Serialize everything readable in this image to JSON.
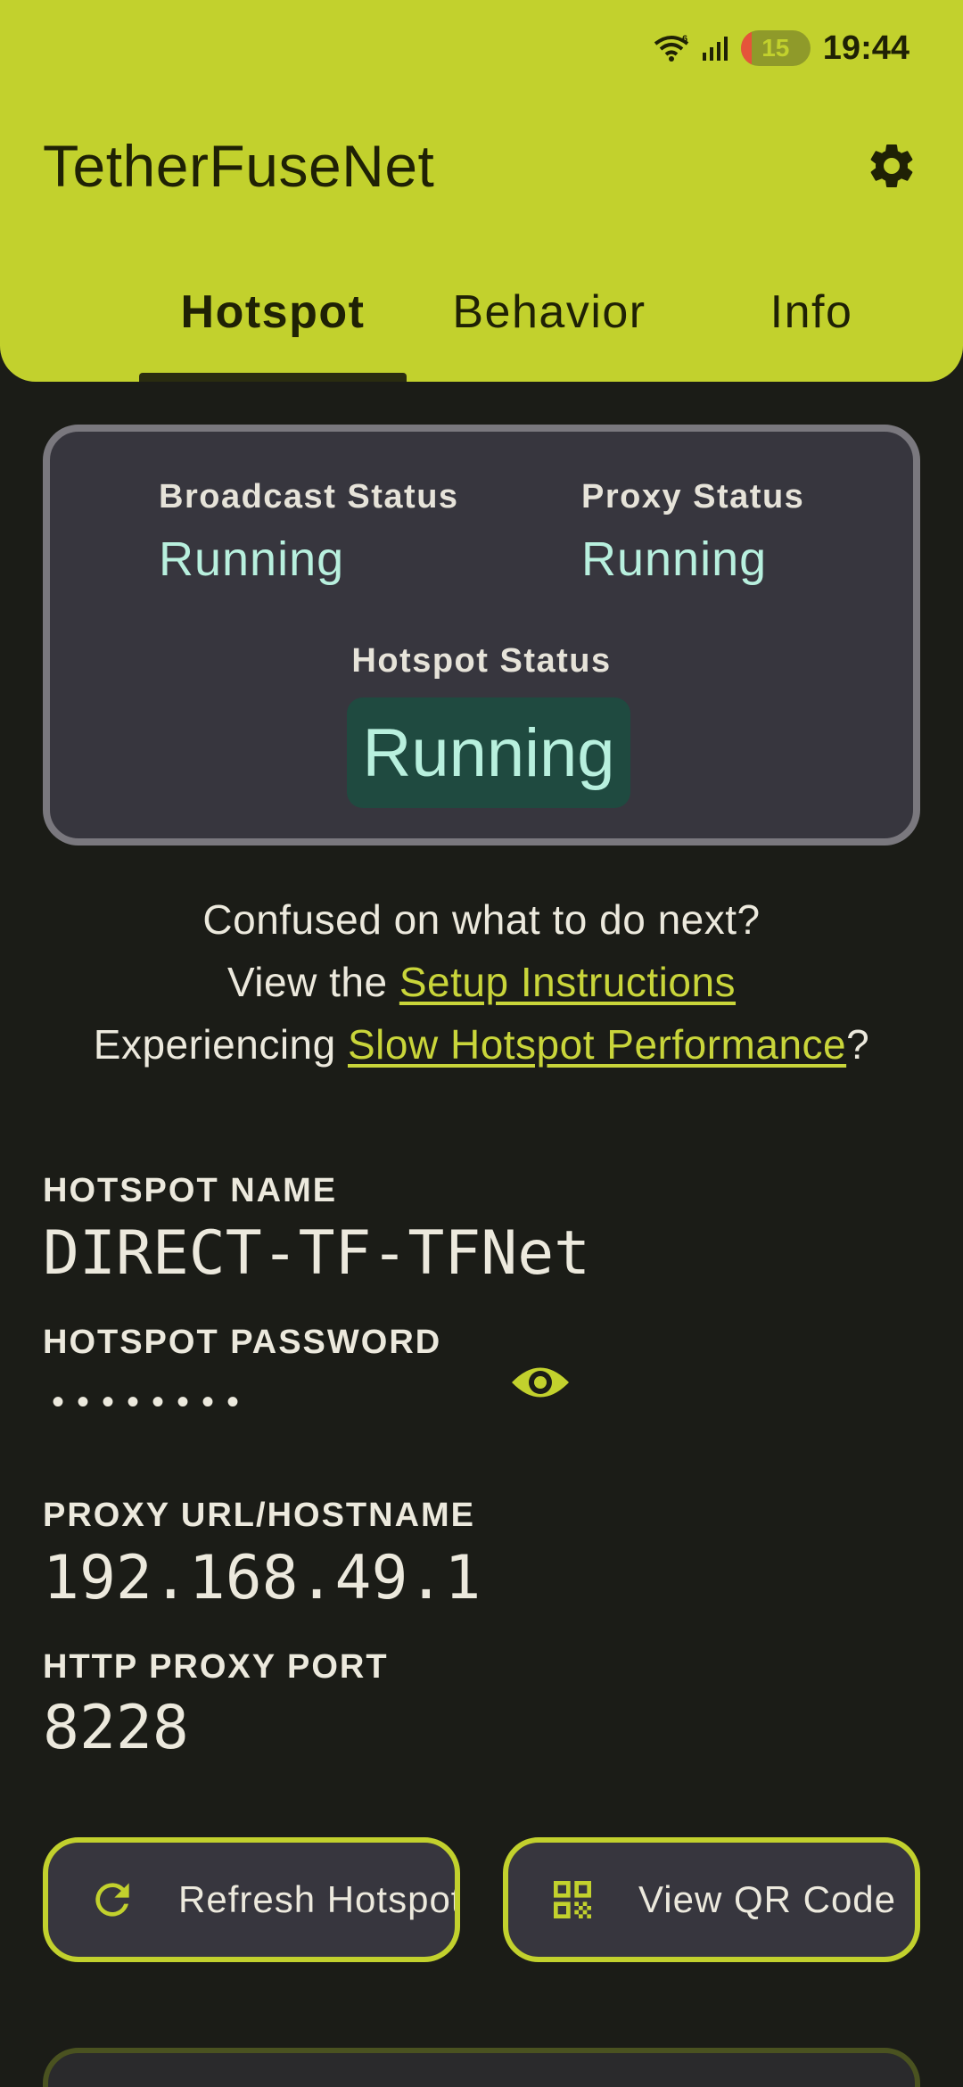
{
  "status_bar": {
    "battery": "15",
    "time": "19:44",
    "wifi_icon": "wifi-6-icon",
    "signal_icon": "cell-signal-icon"
  },
  "header": {
    "title": "TetherFuseNet",
    "settings_icon": "gear-icon",
    "tabs": [
      {
        "label": "Hotspot",
        "active": true
      },
      {
        "label": "Behavior",
        "active": false
      },
      {
        "label": "Info",
        "active": false
      }
    ]
  },
  "status_card": {
    "broadcast": {
      "label": "Broadcast Status",
      "value": "Running"
    },
    "proxy": {
      "label": "Proxy Status",
      "value": "Running"
    },
    "hotspot": {
      "label": "Hotspot Status",
      "value": "Running"
    }
  },
  "help": {
    "line1": "Confused on what to do next?",
    "line2_prefix": "View the ",
    "line2_link": "Setup Instructions",
    "line3_prefix": "Experiencing ",
    "line3_link": "Slow Hotspot Performance",
    "line3_suffix": "?"
  },
  "fields": {
    "hotspot_name": {
      "label": "HOTSPOT NAME",
      "value": "DIRECT-TF-TFNet"
    },
    "hotspot_password": {
      "label": "HOTSPOT PASSWORD",
      "value": "••••••••",
      "toggle_icon": "eye-icon"
    },
    "proxy_url": {
      "label": "PROXY URL/HOSTNAME",
      "value": "192.168.49.1"
    },
    "proxy_port": {
      "label": "HTTP PROXY PORT",
      "value": "8228"
    }
  },
  "actions": {
    "refresh": {
      "label": "Refresh Hotspot",
      "icon": "refresh-icon"
    },
    "qr": {
      "label": "View QR Code",
      "icon": "qr-code-icon"
    }
  },
  "colors": {
    "accent": "#c2d12d",
    "background": "#1b1c17",
    "card": "#37363e",
    "running": "#b8f0de",
    "running_pill": "#1f4a40"
  }
}
